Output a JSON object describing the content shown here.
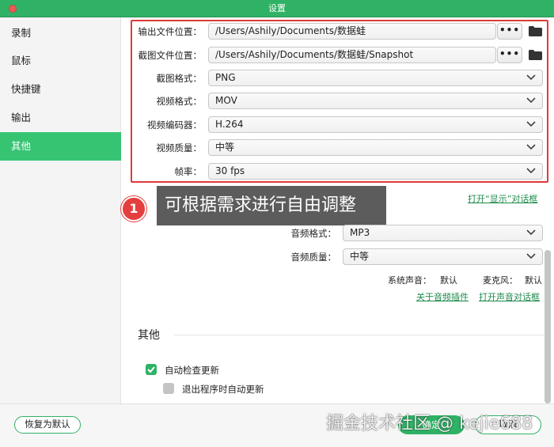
{
  "window": {
    "title": "设置"
  },
  "sidebar": {
    "items": [
      {
        "label": "录制"
      },
      {
        "label": "鼠标"
      },
      {
        "label": "快捷键"
      },
      {
        "label": "输出"
      },
      {
        "label": "其他"
      }
    ],
    "active_index": 4
  },
  "output": {
    "output_location_label": "输出文件位置：",
    "output_location_value": "/Users/Ashily/Documents/数据蛙",
    "screenshot_location_label": "截图文件位置：",
    "screenshot_location_value": "/Users/Ashily/Documents/数据蛙/Snapshot",
    "browse_label": "•••",
    "screenshot_format_label": "截图格式：",
    "screenshot_format_value": "PNG",
    "video_format_label": "视频格式：",
    "video_format_value": "MOV",
    "video_codec_label": "视频编码器：",
    "video_codec_value": "H.264",
    "video_quality_label": "视频质量：",
    "video_quality_value": "中等",
    "frame_rate_label": "帧率：",
    "frame_rate_value": "30 fps",
    "open_display_dialog_link": "打开“显示”对话框"
  },
  "audio": {
    "audio_format_label": "音频格式：",
    "audio_format_value": "MP3",
    "audio_quality_label": "音频质量：",
    "audio_quality_value": "中等",
    "system_sound_label": "系统声音：",
    "system_sound_value": "默认",
    "microphone_label": "麦克风：",
    "microphone_value": "默认",
    "audio_plugin_link": "关于音频插件",
    "open_sound_dialog_link": "打开声音对话框"
  },
  "other": {
    "section_title": "其他",
    "auto_check_update_label": "自动检查更新",
    "auto_check_update_checked": true,
    "auto_update_on_exit_label": "退出程序时自动更新",
    "auto_update_on_exit_checked": false
  },
  "callout": {
    "number": "1",
    "text": "可根据需求进行自由调整"
  },
  "footer": {
    "reset_label": "恢复为默认",
    "confirm_label": "确定",
    "cancel_label": "取消",
    "watermark": "掘金技术社区 @ kejie688"
  },
  "colors": {
    "accent": "#2fb265",
    "highlight_border": "#e03a3a",
    "link": "#1f8a4c"
  }
}
